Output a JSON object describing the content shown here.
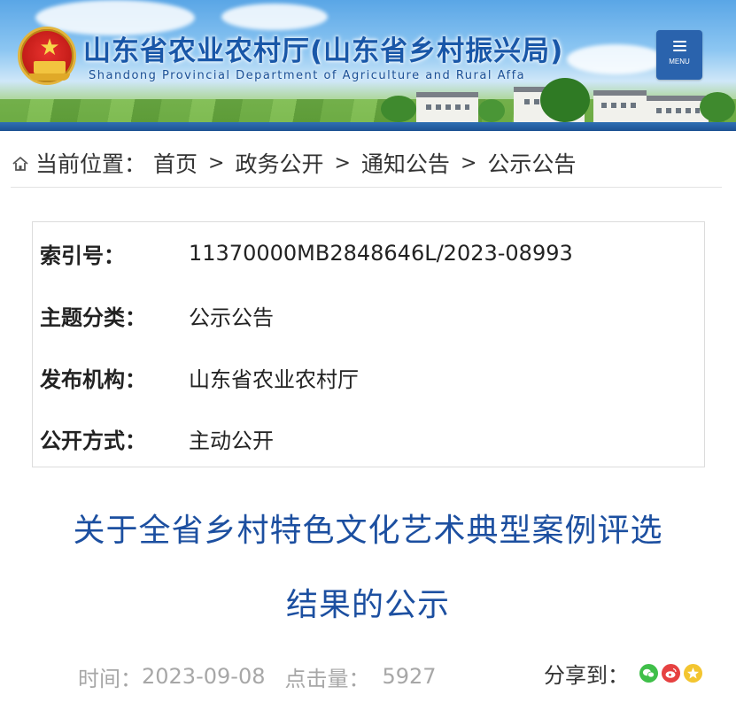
{
  "header": {
    "title": "山东省农业农村厅(山东省乡村振兴局)",
    "subtitle": "Shandong Provincial Department of Agriculture and Rural Affa",
    "menu_label": "MENU"
  },
  "breadcrumb": {
    "prefix": "当前位置：",
    "items": [
      "首页",
      "政务公开",
      "通知公告",
      "公示公告"
    ],
    "separator": ">"
  },
  "info": {
    "rows": [
      {
        "label": "索引号：",
        "value": "11370000MB2848646L/2023-08993"
      },
      {
        "label": "主题分类：",
        "value": "公示公告"
      },
      {
        "label": "发布机构：",
        "value": "山东省农业农村厅"
      },
      {
        "label": "公开方式：",
        "value": "主动公开"
      }
    ]
  },
  "article": {
    "title_line1": "关于全省乡村特色文化艺术典型案例评选",
    "title_line2": "结果的公示"
  },
  "meta": {
    "time_label": "时间：",
    "time_value": "2023-09-08",
    "hits_label": "点击量：",
    "hits_value": "5927"
  },
  "share": {
    "label": "分享到：",
    "icons": [
      "wechat-icon",
      "weibo-icon",
      "qzone-icon"
    ]
  },
  "colors": {
    "brand_blue": "#1957a8",
    "title_blue": "#1c4fa0",
    "menu_bg": "#2a63ad",
    "meta_gray": "#a7a7a7"
  }
}
